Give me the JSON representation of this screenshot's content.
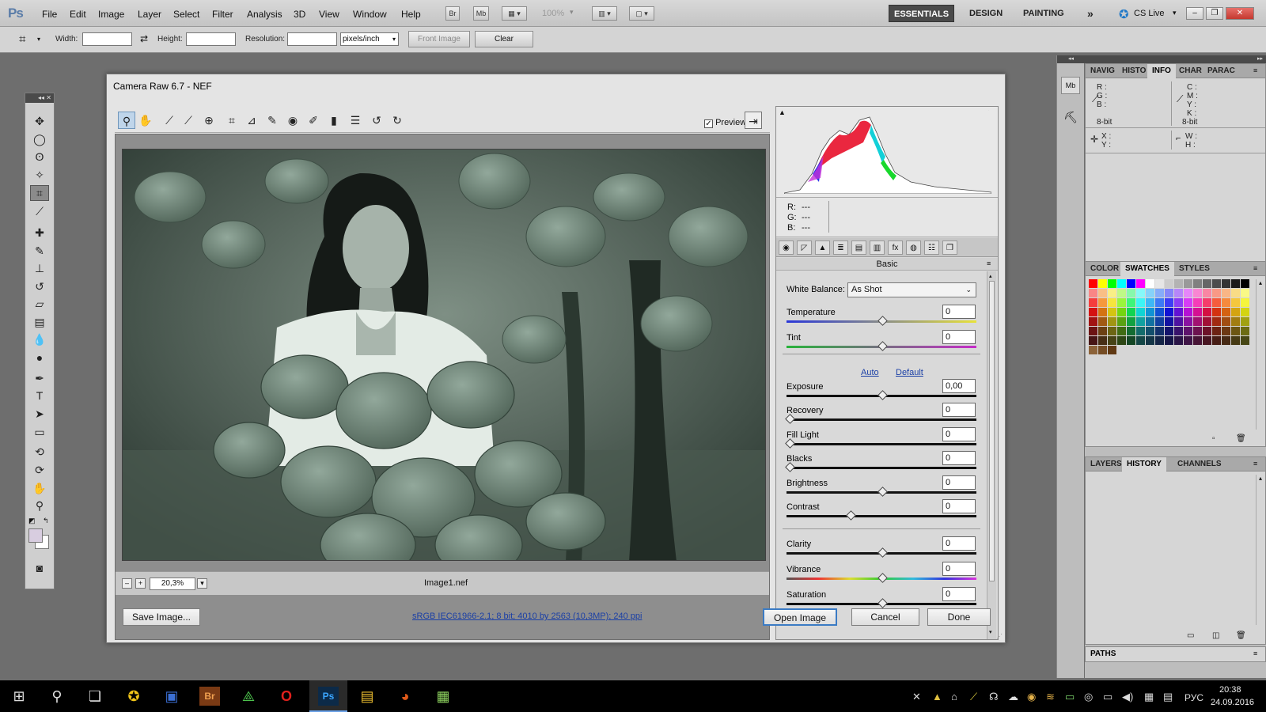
{
  "app": {
    "menu": [
      "File",
      "Edit",
      "Image",
      "Layer",
      "Select",
      "Filter",
      "Analysis",
      "3D",
      "View",
      "Window",
      "Help"
    ],
    "bridge_btn": "Br",
    "minibridge_btn": "Mb",
    "zoom": "100%",
    "workspaces": [
      "ESSENTIALS",
      "DESIGN",
      "PAINTING"
    ],
    "more_workspaces": "»",
    "cs_live": "CS Live"
  },
  "options": {
    "width_label": "Width:",
    "height_label": "Height:",
    "resolution_label": "Resolution:",
    "units": "pixels/inch",
    "front_image": "Front Image",
    "clear": "Clear"
  },
  "panels": {
    "info_tabs": [
      "NAVIG",
      "HISTO",
      "INFO",
      "CHAR",
      "PARAC"
    ],
    "info": {
      "r": "R :",
      "g": "G :",
      "b": "B :",
      "bit_left": "8-bit",
      "c": "C :",
      "m": "M :",
      "y": "Y :",
      "k": "K :",
      "bit_right": "8-bit",
      "x": "X :",
      "yy": "Y :",
      "w": "W :",
      "h": "H :"
    },
    "color_tabs": [
      "COLOR",
      "SWATCHES",
      "STYLES"
    ],
    "history_tabs": [
      "LAYERS",
      "HISTORY",
      "CHANNELS"
    ],
    "paths_tab": "PATHS"
  },
  "camera_raw": {
    "title": "Camera Raw 6.7  -  NEF",
    "preview_label": "Preview",
    "filename": "Image1.nef",
    "zoom": "20,3%",
    "rgb": {
      "r": "R:",
      "g": "G:",
      "b": "B:",
      "rv": "---",
      "gv": "---",
      "bv": "---"
    },
    "panel_title": "Basic",
    "white_balance_label": "White Balance:",
    "white_balance": "As Shot",
    "auto": "Auto",
    "default": "Default",
    "sliders": [
      {
        "label": "Temperature",
        "value": "0",
        "pos": 0.5
      },
      {
        "label": "Tint",
        "value": "0",
        "pos": 0.5
      },
      {
        "label": "Exposure",
        "value": "0,00",
        "pos": 0.5
      },
      {
        "label": "Recovery",
        "value": "0",
        "pos": 0.0
      },
      {
        "label": "Fill Light",
        "value": "0",
        "pos": 0.0
      },
      {
        "label": "Blacks",
        "value": "0",
        "pos": 0.0
      },
      {
        "label": "Brightness",
        "value": "0",
        "pos": 0.5
      },
      {
        "label": "Contrast",
        "value": "0",
        "pos": 0.33
      },
      {
        "label": "Clarity",
        "value": "0",
        "pos": 0.5
      },
      {
        "label": "Vibrance",
        "value": "0",
        "pos": 0.5
      },
      {
        "label": "Saturation",
        "value": "0",
        "pos": 0.5
      }
    ],
    "save_image": "Save Image...",
    "workflow": "sRGB IEC61966-2.1; 8 bit; 4010 by 2563 (10,3MP); 240 ppi",
    "open_image": "Open Image",
    "cancel": "Cancel",
    "done": "Done"
  },
  "taskbar": {
    "lang": "РУС",
    "time": "20:38",
    "date": "24.09.2016"
  }
}
